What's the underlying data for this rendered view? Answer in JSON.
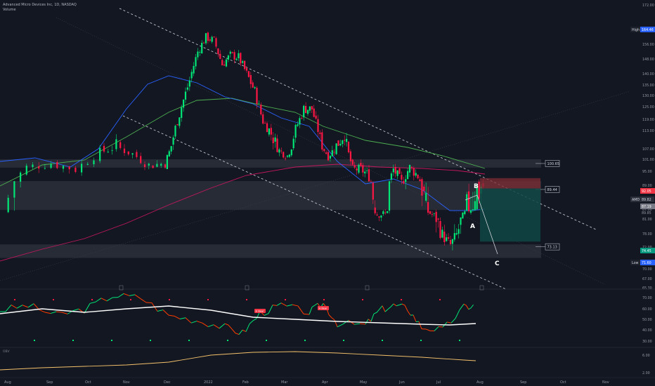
{
  "legend": {
    "title": "Advanced Micro Devices Inc, 1D, NASDAQ",
    "indicator": "Volume"
  },
  "chart_data": {
    "type": "candlestick",
    "price_axis": {
      "ticks": [
        172.0,
        164.0,
        156.0,
        148.0,
        140.0,
        135.0,
        130.0,
        125.0,
        119.0,
        113.0,
        107.0,
        101.0,
        95.0,
        89.0,
        87.0,
        81.0,
        78.0,
        72.0,
        70.0,
        67.0,
        65.3
      ],
      "ylim": [
        65.3,
        172
      ],
      "high_label": "High",
      "high_value": "164.46",
      "low_label": "Low",
      "low_value": "71.60",
      "current_price": "89.85",
      "current_countdown": "87.19",
      "target_price": "74.45",
      "short_entry": "92.05",
      "ticker_label": "AMD",
      "ticker_price": "89.82"
    },
    "date_axis": [
      "Aug",
      "Sep",
      "Oct",
      "Nov",
      "Dec",
      "2022",
      "Feb",
      "Mar",
      "Apr",
      "May",
      "Jun",
      "Jul",
      "Aug",
      "Sep",
      "Oct",
      "Nov"
    ],
    "close_path": [
      [
        0,
        85
      ],
      [
        3,
        97
      ],
      [
        6,
        99
      ],
      [
        9,
        96
      ],
      [
        12,
        105
      ],
      [
        14,
        108
      ],
      [
        16,
        104
      ],
      [
        18,
        98
      ],
      [
        20,
        99
      ],
      [
        21,
        111
      ],
      [
        22,
        125
      ],
      [
        23,
        137
      ],
      [
        24,
        152
      ],
      [
        25,
        160
      ],
      [
        26,
        158
      ],
      [
        27,
        145
      ],
      [
        28,
        150
      ],
      [
        29,
        149
      ],
      [
        30,
        140
      ],
      [
        31,
        132
      ],
      [
        32,
        118
      ],
      [
        33,
        112
      ],
      [
        34,
        106
      ],
      [
        35,
        103
      ],
      [
        36,
        114
      ],
      [
        37,
        124
      ],
      [
        38,
        124
      ],
      [
        39,
        110
      ],
      [
        40,
        103
      ],
      [
        41,
        108
      ],
      [
        42,
        112
      ],
      [
        43,
        96
      ],
      [
        44,
        96
      ],
      [
        45,
        93
      ],
      [
        46,
        84
      ],
      [
        47,
        84
      ],
      [
        48,
        96
      ],
      [
        49,
        90
      ],
      [
        50,
        97
      ],
      [
        51,
        93
      ],
      [
        52,
        86
      ],
      [
        53,
        83
      ],
      [
        54,
        77
      ],
      [
        55,
        73
      ],
      [
        56,
        79
      ],
      [
        57,
        86
      ],
      [
        58,
        89
      ],
      [
        59,
        89
      ]
    ],
    "levels": [
      {
        "value": "100.65",
        "band_low": 96.8,
        "band_high": 101.0
      },
      {
        "value": "89.44",
        "band_low": 86.5,
        "band_high": 90.8
      },
      {
        "value": "73.13",
        "band_low": 71.0,
        "band_high": 73.2
      }
    ],
    "wave_labels": [
      "B",
      "A",
      "C"
    ],
    "rsi_panel": {
      "ticks": [
        "70.00",
        "60.00",
        "50.00",
        "40.00",
        "30.00"
      ],
      "markers": [
        "H Bear",
        "H Bear"
      ]
    },
    "volume_panel": {
      "label": "OBV",
      "ticks": [
        "6.00",
        "2.00"
      ]
    }
  }
}
